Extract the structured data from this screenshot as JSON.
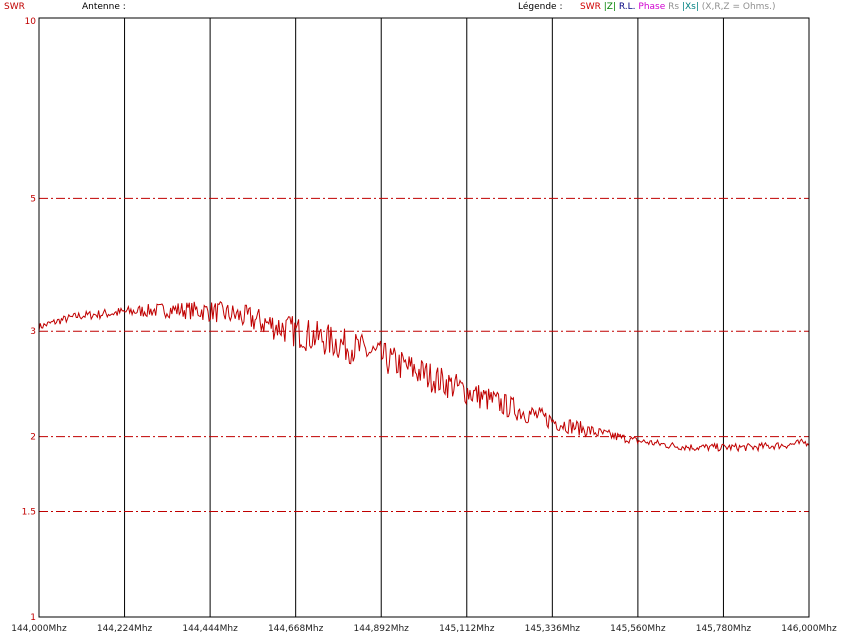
{
  "header": {
    "ylabel": "SWR",
    "antenna_label": "Antenne :",
    "legend_label": "Légende :",
    "legend_items": [
      {
        "text": "SWR",
        "color": "#d00000"
      },
      {
        "text": "|Z|",
        "color": "#008000"
      },
      {
        "text": "R.L.",
        "color": "#000080"
      },
      {
        "text": "Phase",
        "color": "#d000d0"
      },
      {
        "text": "Rs",
        "color": "#909090"
      },
      {
        "text": "|Xs|",
        "color": "#008080"
      },
      {
        "text": "(X,R,Z = Ohms.)",
        "color": "#909090"
      }
    ]
  },
  "chart_data": {
    "type": "line",
    "ylabel": "SWR",
    "xlabel": "",
    "y_scale": "log",
    "ylim": [
      1,
      10
    ],
    "xlim": [
      144.0,
      146.0
    ],
    "yticks": [
      1,
      1.5,
      2,
      3,
      5,
      10
    ],
    "ytick_labels": [
      "1",
      "1.5",
      "2",
      "3",
      "5",
      "10"
    ],
    "dashed_gridlines_y": [
      1.5,
      2,
      3,
      5
    ],
    "xtick_labels": [
      "144,000Mhz",
      "144,224Mhz",
      "144,444Mhz",
      "144,668Mhz",
      "144,892Mhz",
      "145,112Mhz",
      "145,336Mhz",
      "145,560Mhz",
      "145,780Mhz",
      "146,000Mhz"
    ],
    "grid": true,
    "series": [
      {
        "color": "#c00000",
        "x": [
          144.0,
          144.05,
          144.1,
          144.15,
          144.2,
          144.25,
          144.3,
          144.35,
          144.4,
          144.45,
          144.5,
          144.55,
          144.6,
          144.65,
          144.7,
          144.75,
          144.8,
          144.85,
          144.9,
          144.95,
          145.0,
          145.05,
          145.1,
          145.15,
          145.2,
          145.25,
          145.3,
          145.35,
          145.4,
          145.45,
          145.5,
          145.55,
          145.6,
          145.65,
          145.7,
          145.75,
          145.8,
          145.85,
          145.9,
          145.95,
          146.0
        ],
        "y": [
          3.05,
          3.12,
          3.18,
          3.2,
          3.22,
          3.24,
          3.25,
          3.26,
          3.25,
          3.24,
          3.2,
          3.15,
          3.08,
          3.02,
          2.96,
          2.9,
          2.84,
          2.78,
          2.7,
          2.62,
          2.55,
          2.47,
          2.4,
          2.33,
          2.27,
          2.21,
          2.16,
          2.11,
          2.07,
          2.03,
          2.0,
          1.97,
          1.95,
          1.93,
          1.92,
          1.92,
          1.92,
          1.92,
          1.93,
          1.94,
          1.96
        ]
      }
    ]
  }
}
